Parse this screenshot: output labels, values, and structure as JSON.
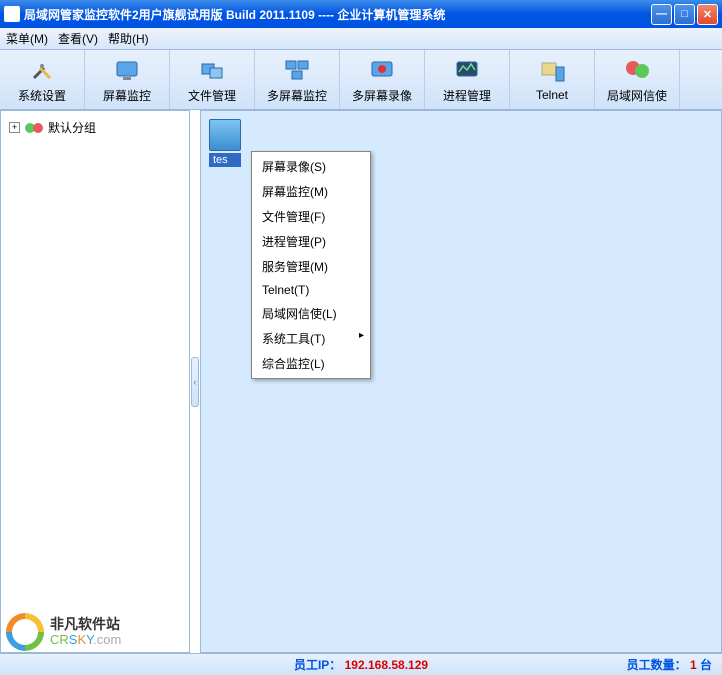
{
  "titlebar": {
    "text": "局域网管家监控软件2用户旗舰试用版   Build 2011.1109    ----  企业计算机管理系统"
  },
  "menubar": {
    "items": [
      {
        "label": "菜单(M)"
      },
      {
        "label": "查看(V)"
      },
      {
        "label": "帮助(H)"
      }
    ]
  },
  "toolbar": {
    "buttons": [
      {
        "label": "系统设置",
        "icon": "settings"
      },
      {
        "label": "屏幕监控",
        "icon": "monitor"
      },
      {
        "label": "文件管理",
        "icon": "files"
      },
      {
        "label": "多屏幕监控",
        "icon": "multi-monitor"
      },
      {
        "label": "多屏幕录像",
        "icon": "multi-record"
      },
      {
        "label": "进程管理",
        "icon": "process"
      },
      {
        "label": "Telnet",
        "icon": "telnet"
      },
      {
        "label": "局域网信使",
        "icon": "messenger"
      }
    ]
  },
  "tree": {
    "root": {
      "label": "默认分组"
    }
  },
  "client": {
    "label": "tes"
  },
  "context_menu": {
    "items": [
      {
        "label": "屏幕录像(S)"
      },
      {
        "label": "屏幕监控(M)"
      },
      {
        "label": "文件管理(F)"
      },
      {
        "label": "进程管理(P)"
      },
      {
        "label": "服务管理(M)"
      },
      {
        "label": "Telnet(T)"
      },
      {
        "label": "局域网信使(L)"
      },
      {
        "label": "系统工具(T)",
        "has_sub": true
      },
      {
        "label": "综合监控(L)"
      }
    ]
  },
  "statusbar": {
    "ip_label": "员工IP：",
    "ip_value": "192.168.58.129",
    "count_label": "员工数量：",
    "count_value": "1",
    "count_unit": " 台"
  },
  "watermark": {
    "cn": "非凡软件站",
    "en_1": "CR",
    "en_2": "S",
    "en_3": "K",
    "en_4": "Y",
    "en_5": ".com"
  }
}
